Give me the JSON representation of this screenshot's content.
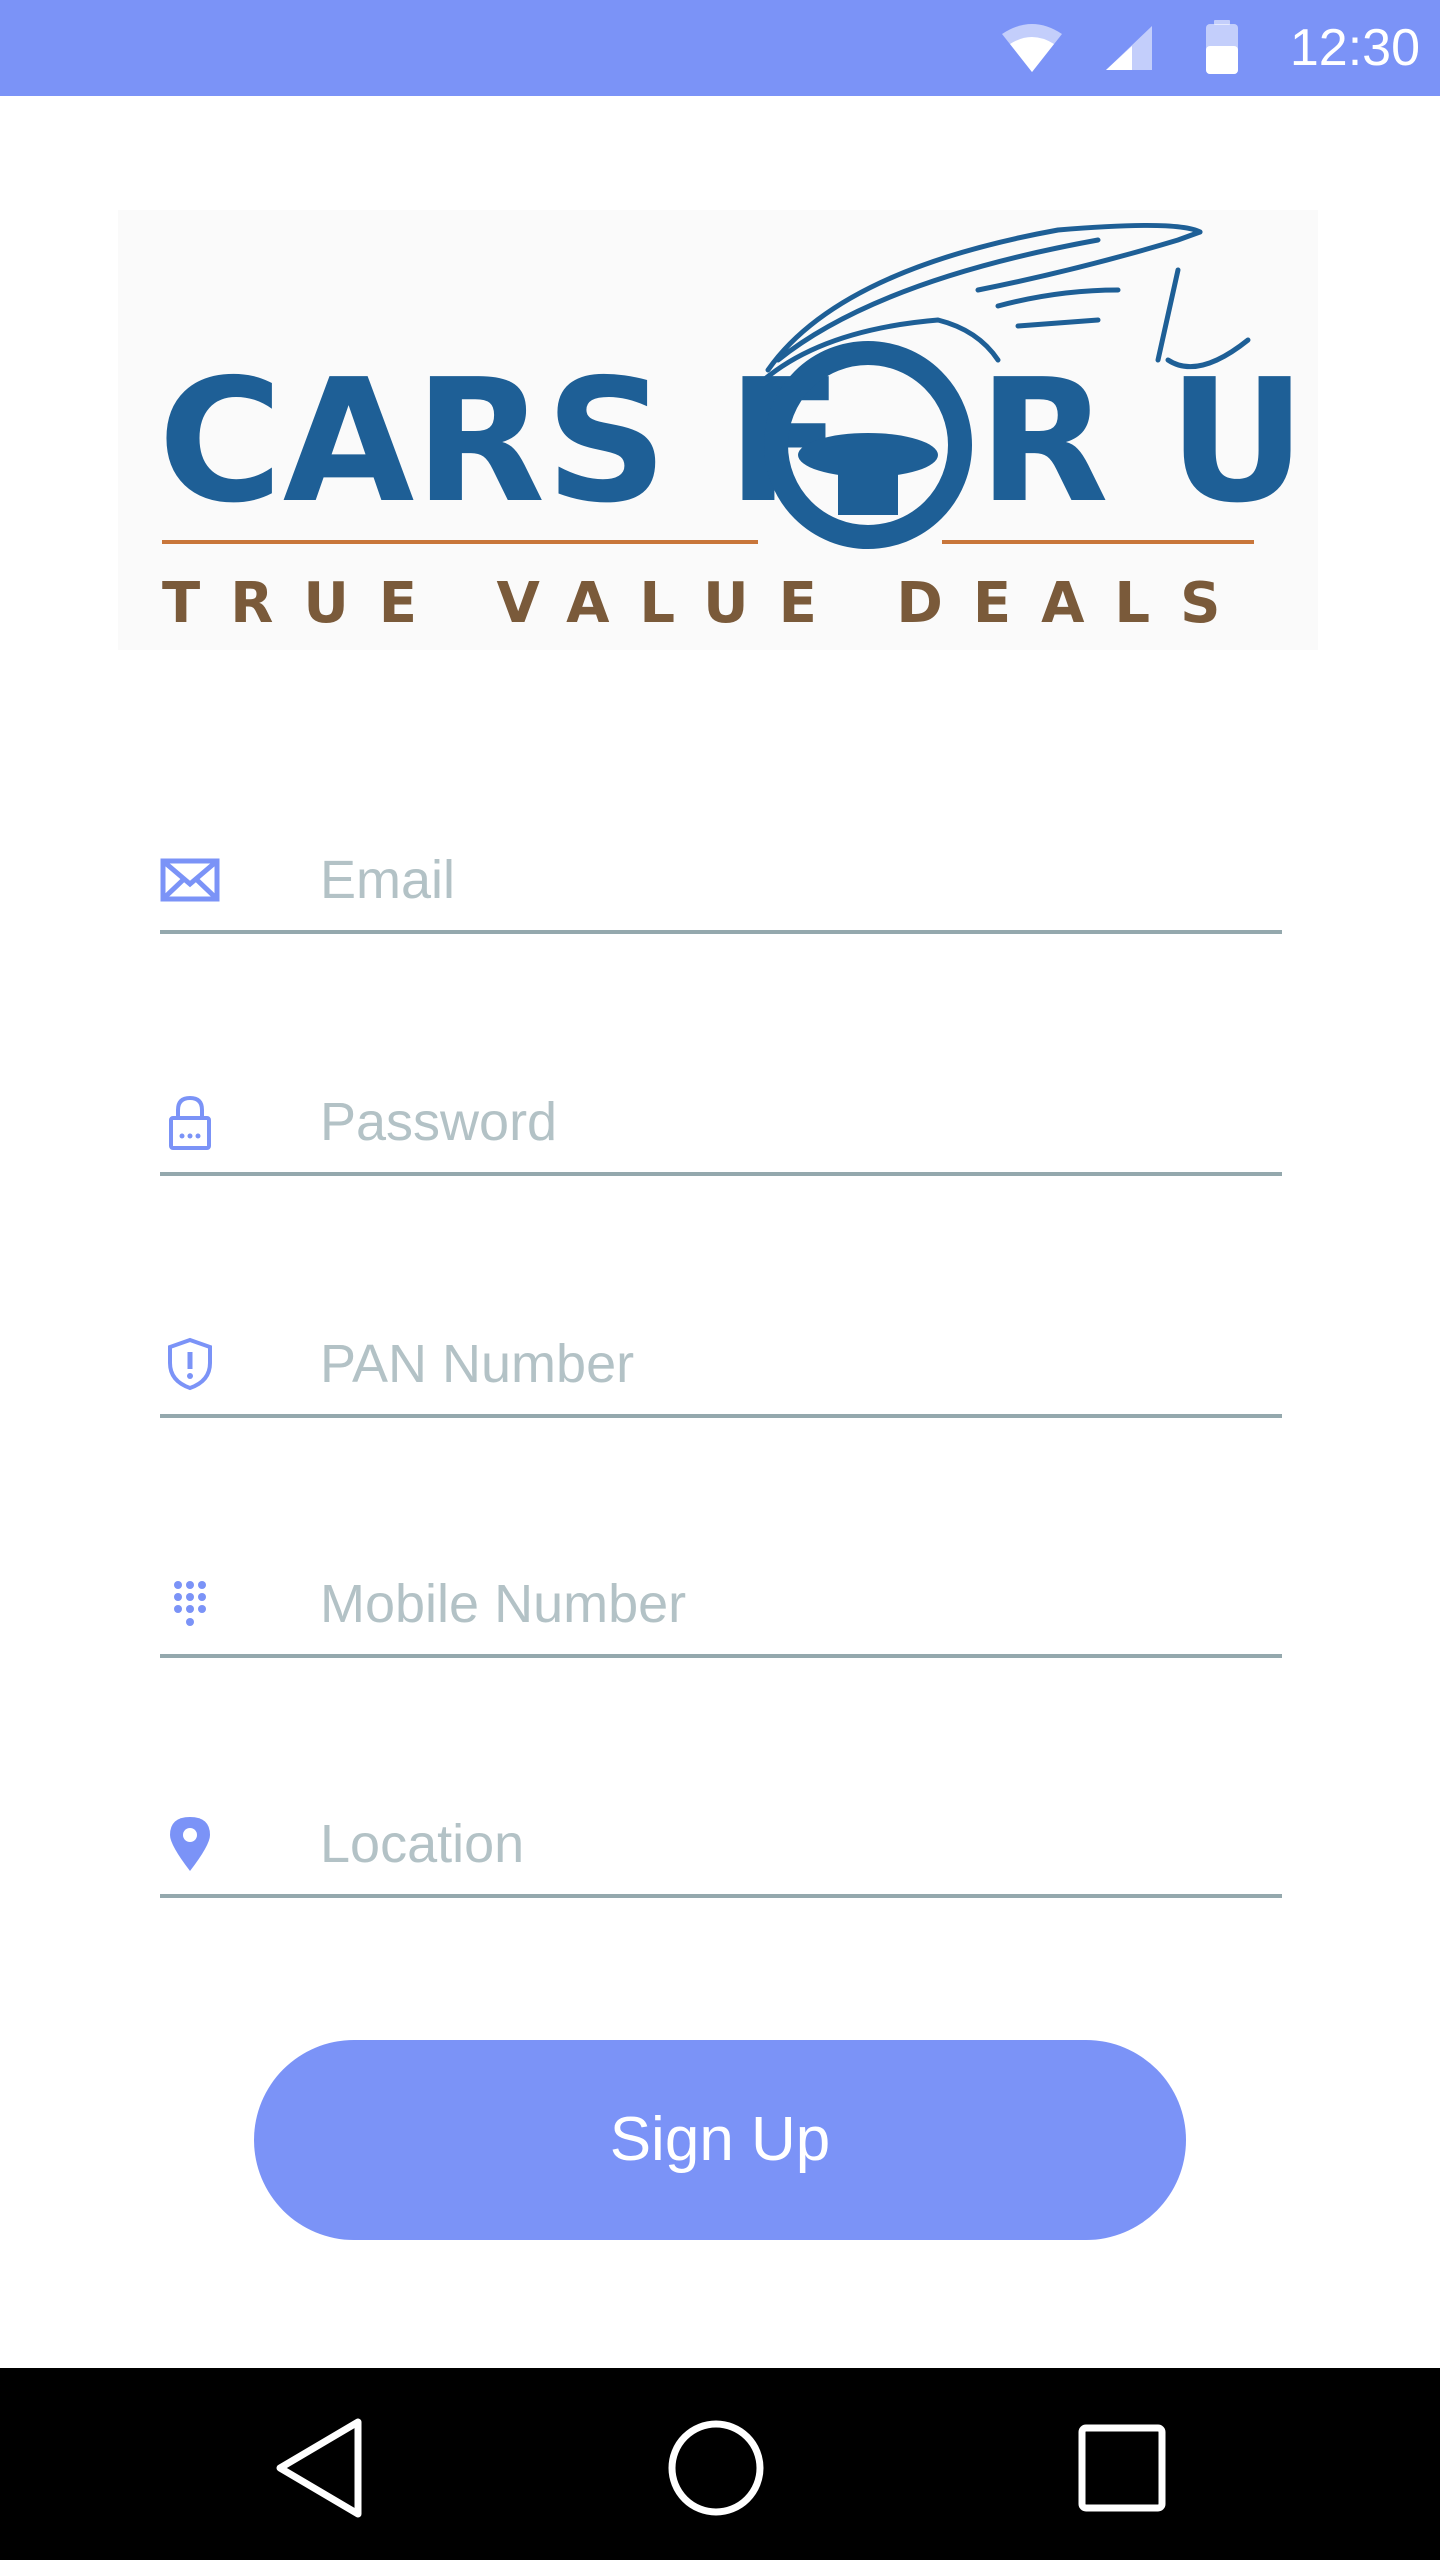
{
  "status_bar": {
    "time": "12:30",
    "icons": [
      "wifi-icon",
      "signal-icon",
      "battery-icon"
    ]
  },
  "logo": {
    "brand_text": "CARS FOR U",
    "tagline": "TRUE VALUE DEALS"
  },
  "form": {
    "fields": [
      {
        "icon": "mail-icon",
        "placeholder": "Email",
        "value": ""
      },
      {
        "icon": "lock-icon",
        "placeholder": "Password",
        "value": ""
      },
      {
        "icon": "shield-icon",
        "placeholder": "PAN Number",
        "value": ""
      },
      {
        "icon": "dialpad-icon",
        "placeholder": "Mobile Number",
        "value": ""
      },
      {
        "icon": "location-pin-icon",
        "placeholder": "Location",
        "value": ""
      }
    ],
    "submit_label": "Sign Up"
  },
  "nav_bar": {
    "buttons": [
      "back-icon",
      "home-icon",
      "recent-apps-icon"
    ]
  },
  "colors": {
    "accent": "#7b93f7",
    "logo_blue": "#1e5f96",
    "logo_brown": "#7a5a3a",
    "logo_orange": "#c8763a",
    "underline": "#94a8ad",
    "placeholder": "#b3c2c6"
  }
}
